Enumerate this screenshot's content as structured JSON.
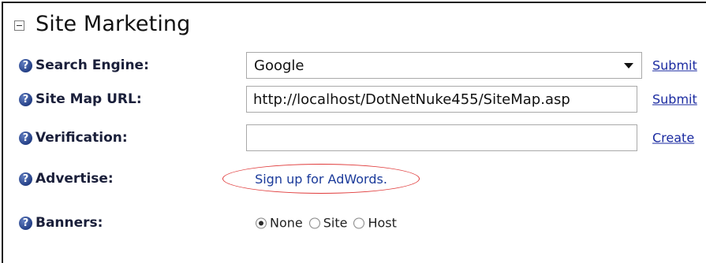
{
  "section": {
    "title": "Site Marketing"
  },
  "rows": {
    "search_engine": {
      "label": "Search Engine:",
      "value": "Google",
      "action": "Submit"
    },
    "site_map": {
      "label": "Site Map URL:",
      "value": "http://localhost/DotNetNuke455/SiteMap.asp",
      "action": "Submit"
    },
    "verification": {
      "label": "Verification:",
      "value": "",
      "action": "Create"
    },
    "advertise": {
      "label": "Advertise:",
      "link": "Sign up for AdWords."
    },
    "banners": {
      "label": "Banners:",
      "options": [
        "None",
        "Site",
        "Host"
      ],
      "selected": "None"
    }
  },
  "icons": {
    "help": "help-icon"
  },
  "colors": {
    "link": "#1a2aa0",
    "highlight_oval": "#e03a3a",
    "help_icon": "#2e4a8f"
  }
}
